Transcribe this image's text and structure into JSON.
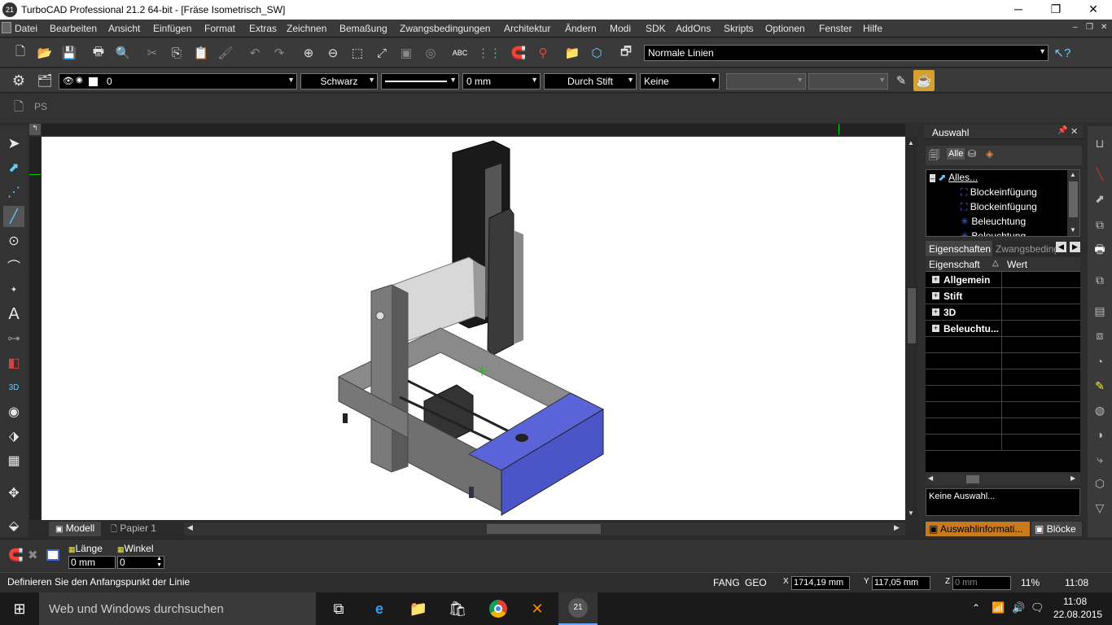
{
  "window": {
    "title": "TurboCAD Professional 21.2 64-bit - [Fräse Isometrisch_SW]",
    "app_icon": "21"
  },
  "menu": [
    "Datei",
    "Bearbeiten",
    "Ansicht",
    "Einfügen",
    "Format",
    "Extras",
    "Zeichnen",
    "Bemaßung",
    "Zwangsbedingungen",
    "Architektur",
    "Ändern",
    "Modi",
    "SDK",
    "AddOns",
    "Skripts",
    "Optionen",
    "Fenster",
    "Hilfe"
  ],
  "toolbar1": {
    "linestyle": "Normale Linien"
  },
  "toolbar2": {
    "layer": "0",
    "color": "Schwarz",
    "width": "0 mm",
    "pen": "Durch Stift",
    "fill": "Keine"
  },
  "tabs": {
    "ps": "PS",
    "model": "Modell",
    "paper": "Papier 1"
  },
  "panel": {
    "title": "Auswahl",
    "filter_all": "Alle",
    "tree": [
      "Alles...",
      "Blockeinfügung",
      "Blockeinfügung",
      "Beleuchtung",
      "Beleuchtung"
    ],
    "tabs": [
      "Eigenschaften",
      "Zwangsbeding"
    ],
    "col_prop": "Eigenschaft",
    "col_value": "Wert",
    "groups": [
      "Allgemein",
      "Stift",
      "3D",
      "Beleuchtu..."
    ],
    "info": "Keine Auswahl...",
    "bottom_tabs": [
      "Auswahlinformati...",
      "Blöcke"
    ]
  },
  "inspector": {
    "length_label": "Länge",
    "length_value": "0 mm",
    "angle_label": "Winkel",
    "angle_value": "0"
  },
  "status": {
    "prompt": "Definieren Sie den Anfangspunkt der Linie",
    "fang": "FANG",
    "geo": "GEO",
    "x": "1714,19 mm",
    "y": "117,05 mm",
    "z": "0 mm",
    "zoom": "11%",
    "time": "11:08"
  },
  "taskbar": {
    "search": "Web und Windows durchsuchen",
    "time": "11:08",
    "date": "22.08.2015"
  },
  "colors": {
    "bg": "#2d2d2d",
    "accent": "#4b55c8"
  }
}
